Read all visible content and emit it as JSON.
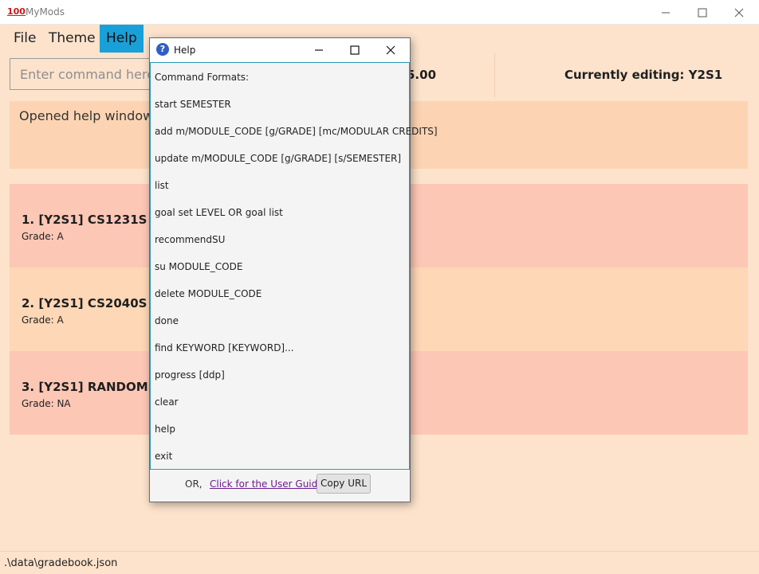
{
  "window": {
    "app_icon_text": "100",
    "title": "MyMods",
    "controls": [
      "minimize-icon",
      "maximize-icon",
      "close-icon"
    ]
  },
  "menu": {
    "file": "File",
    "theme": "Theme",
    "help": "Help"
  },
  "command_box": {
    "placeholder": "Enter command here..."
  },
  "info_bar": {
    "cap_value": "5.00",
    "currently_editing": "Currently editing: Y2S1"
  },
  "result": {
    "text": "Opened help window."
  },
  "modules": [
    {
      "title": "1.  [Y2S1] CS1231S (4M",
      "grade": "Grade: A",
      "color": "#fdc7b6"
    },
    {
      "title": "2.  [Y2S1] CS2040S (4M",
      "grade": "Grade: A",
      "color": "#fdd7b6"
    },
    {
      "title": "3.  [Y2S1] RANDOM (1",
      "grade": "Grade: NA",
      "color": "#fdc7b6"
    }
  ],
  "status_bar": {
    "path": ".\\data\\gradebook.json"
  },
  "help_window": {
    "icon": "question-icon",
    "title": "Help",
    "lines": [
      "Command Formats:",
      "start SEMESTER",
      "add m/MODULE_CODE [g/GRADE] [mc/MODULAR CREDITS]",
      "update m/MODULE_CODE [g/GRADE] [s/SEMESTER]",
      "list",
      "goal set LEVEL OR goal list",
      "recommendSU",
      "su MODULE_CODE",
      "delete MODULE_CODE",
      "done",
      "find KEYWORD [KEYWORD]...",
      "progress [ddp]",
      "clear",
      "help",
      "exit"
    ],
    "or_label": "OR,",
    "guide_link": "Click for the User Guide",
    "copy_button": "Copy URL"
  },
  "colors": {
    "background": "#fde3cc",
    "menu_active": "#1aa0d8",
    "link": "#6b1d8e"
  }
}
